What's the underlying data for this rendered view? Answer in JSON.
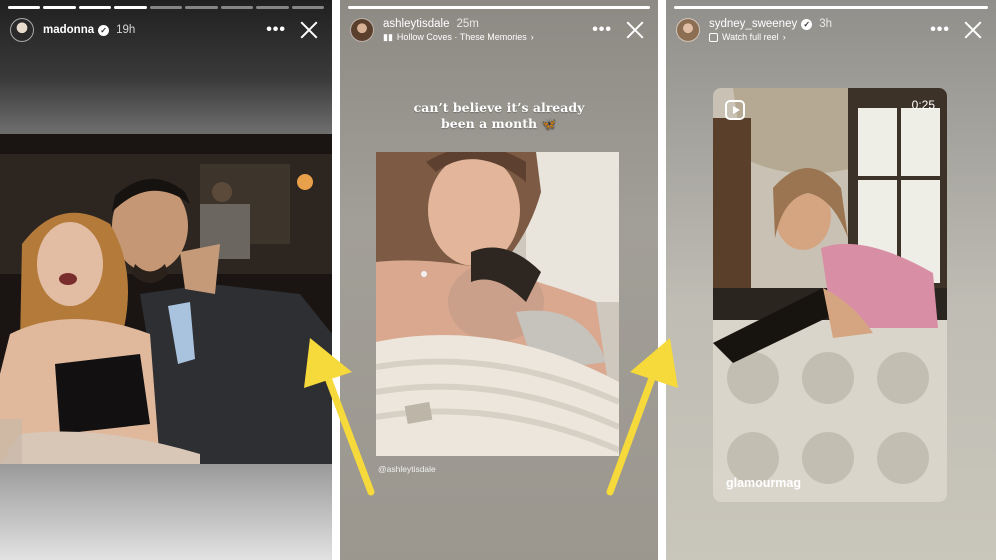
{
  "stories": [
    {
      "username": "madonna",
      "time": "19h",
      "more_icon": "more-dots-icon",
      "close_icon": "close-icon",
      "progress": {
        "segments": 9,
        "viewed": 4
      }
    },
    {
      "username": "ashleytisdale",
      "time": "25m",
      "music": "Hollow Coves · These Memories",
      "caption_line1": "can’t believe it’s already",
      "caption_line2": "been a month 🦋",
      "mention": "@ashleytisdale",
      "progress": {
        "segments": 1,
        "viewed": 1
      }
    },
    {
      "username": "sydney_sweeney",
      "time": "3h",
      "watch_label": "Watch full reel",
      "reel_duration": "0:25",
      "reel_username": "glamourmag",
      "progress": {
        "segments": 1,
        "viewed": 1
      }
    }
  ],
  "colors": {
    "arrow": "#f6d93a",
    "ui_text": "#ffffff"
  }
}
